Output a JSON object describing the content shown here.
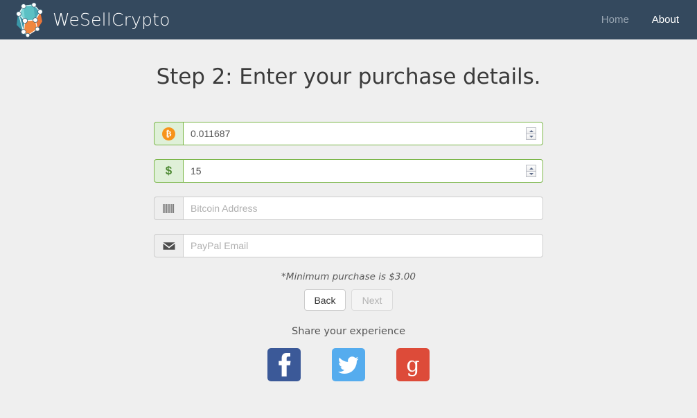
{
  "navbar": {
    "brand_name": "WeSellCrypto",
    "brand_logo_icon": "crystal-network-logo-icon",
    "links": [
      {
        "label": "Home",
        "active": false
      },
      {
        "label": "About",
        "active": true
      }
    ],
    "background_color": "#34495e",
    "link_color": "#97a4b1",
    "active_link_color": "#ffffff"
  },
  "page": {
    "title": "Step 2: Enter your purchase details.",
    "background_color": "#efefef"
  },
  "form": {
    "fields": [
      {
        "name": "bitcoin-amount",
        "icon": "bitcoin-icon",
        "value": "0.011687",
        "placeholder": "",
        "state": "valid",
        "has_spinner": true
      },
      {
        "name": "usd-amount",
        "icon": "dollar-icon",
        "value": "15",
        "placeholder": "",
        "state": "valid",
        "has_spinner": true
      },
      {
        "name": "bitcoin-address",
        "icon": "barcode-icon",
        "value": "",
        "placeholder": "Bitcoin Address",
        "state": "default",
        "has_spinner": false
      },
      {
        "name": "paypal-email",
        "icon": "envelope-icon",
        "value": "",
        "placeholder": "PayPal Email",
        "state": "default",
        "has_spinner": false
      }
    ],
    "minimum_note": "*Minimum purchase is $3.00",
    "valid_border_color": "#7ab648",
    "valid_addon_background": "#dff0d8"
  },
  "buttons": {
    "back_label": "Back",
    "next_label": "Next",
    "next_disabled": true
  },
  "social": {
    "heading": "Share your experience",
    "items": [
      {
        "name": "facebook",
        "icon": "facebook-icon",
        "color": "#3b5998"
      },
      {
        "name": "twitter",
        "icon": "twitter-icon",
        "color": "#55acee"
      },
      {
        "name": "googleplus",
        "icon": "google-plus-icon",
        "color": "#dd4b39"
      }
    ]
  }
}
